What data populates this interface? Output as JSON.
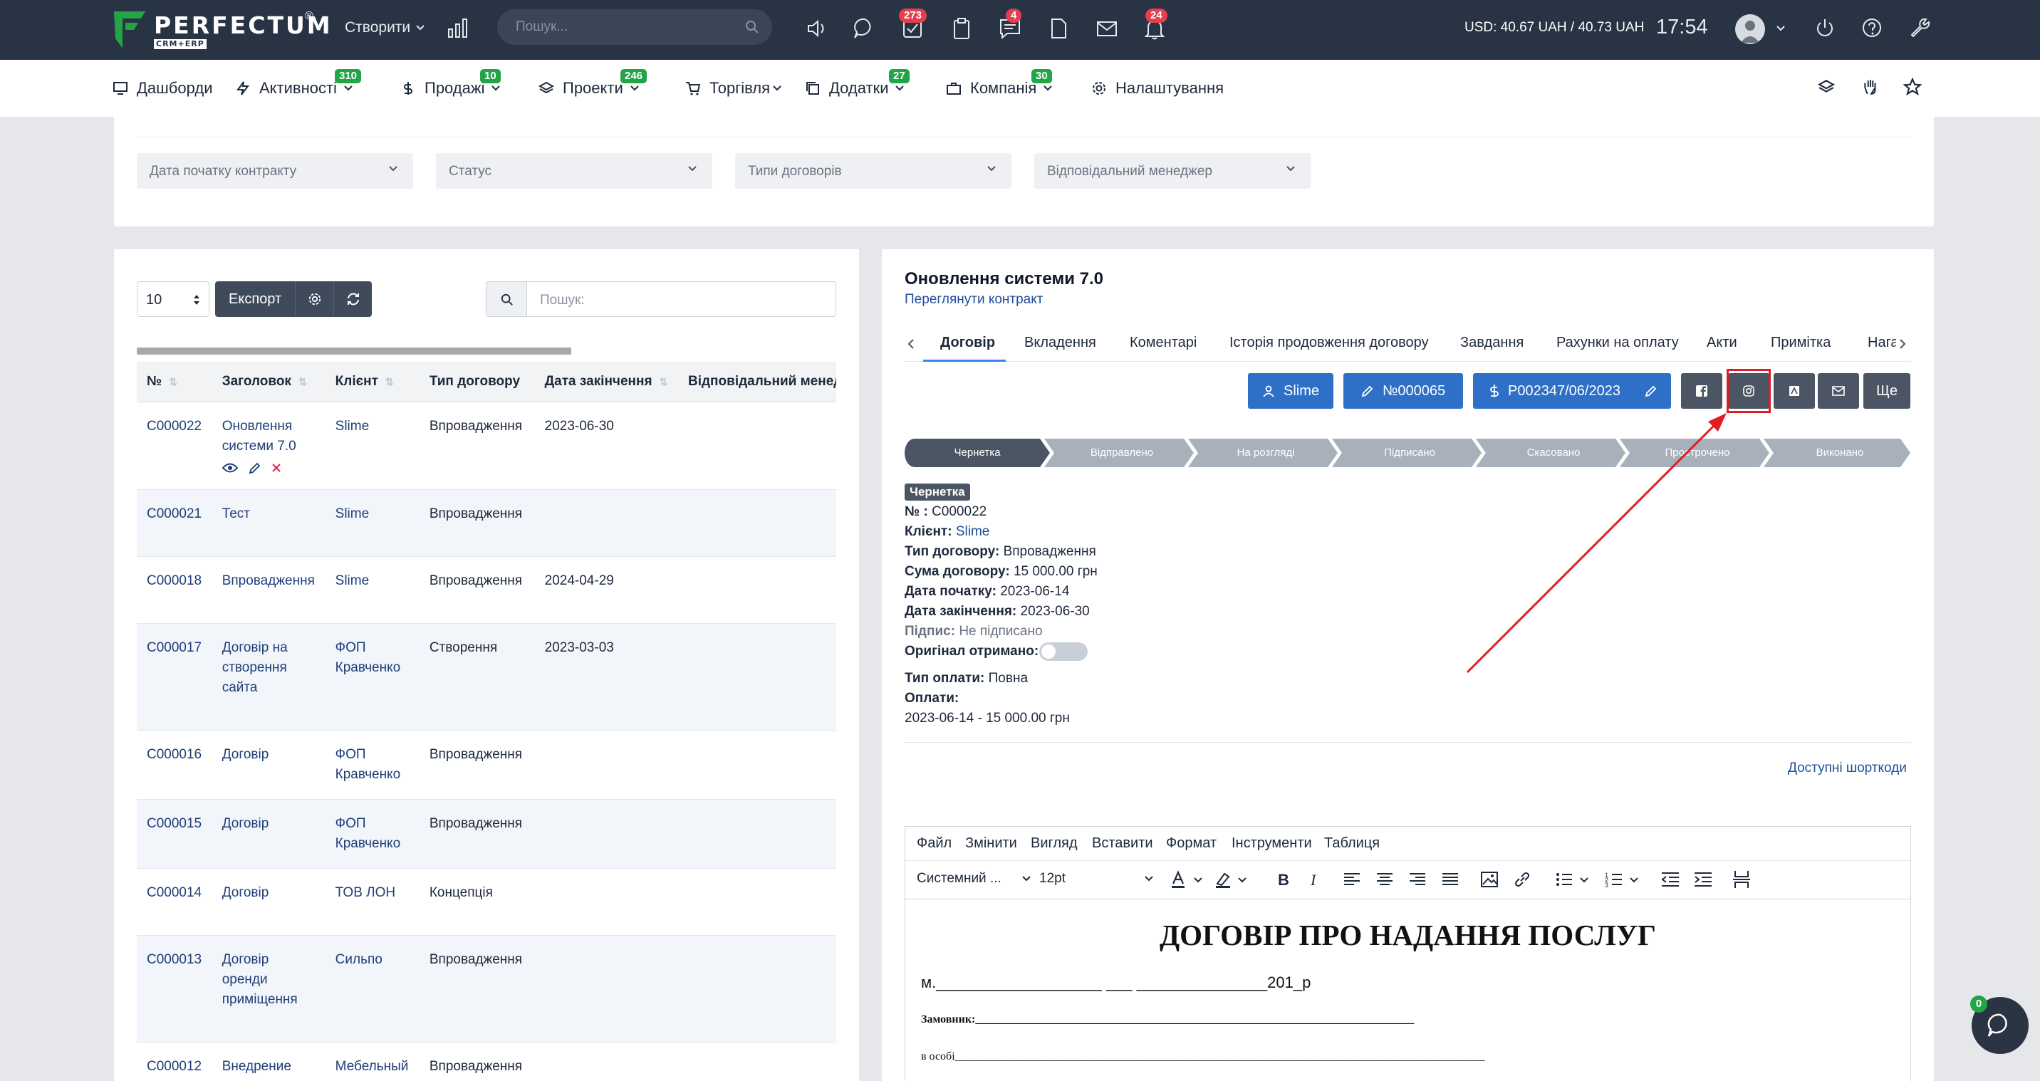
{
  "topbar": {
    "logo_text": "PERFECTUM",
    "logo_sub": "CRM+ERP",
    "logo_reg": "®",
    "create_label": "Створити",
    "search_placeholder": "Пошук...",
    "badges": {
      "tasks": "273",
      "chat": "4",
      "notifications": "24"
    },
    "rate": "USD: 40.67 UAH / 40.73 UAH",
    "clock": "17:54"
  },
  "nav": {
    "items": [
      {
        "label": "Дашборди",
        "badge": ""
      },
      {
        "label": "Активності",
        "badge": "310"
      },
      {
        "label": "Продажі",
        "badge": "10"
      },
      {
        "label": "Проекти",
        "badge": "246"
      },
      {
        "label": "Торгівля",
        "badge": ""
      },
      {
        "label": "Додатки",
        "badge": "27"
      },
      {
        "label": "Компанія",
        "badge": "30"
      },
      {
        "label": "Налаштування",
        "badge": ""
      }
    ]
  },
  "filters": [
    "Дата початку контракту",
    "Статус",
    "Типи договорів",
    "Відповідальний менеджер"
  ],
  "table": {
    "page_size": "10",
    "export_label": "Експорт",
    "search_placeholder": "Пошук:",
    "headers": [
      "№",
      "Заголовок",
      "Клієнт",
      "Тип договору",
      "Дата закінчення",
      "Відповідальний менеджер"
    ],
    "rows": [
      {
        "id": "C000022",
        "title": "Оновлення системи 7.0",
        "client": "Slime",
        "type": "Впровадження",
        "end": "2023-06-30"
      },
      {
        "id": "C000021",
        "title": "Тест",
        "client": "Slime",
        "type": "Впровадження",
        "end": ""
      },
      {
        "id": "C000018",
        "title": "Впровадження",
        "client": "Slime",
        "type": "Впровадження",
        "end": "2024-04-29"
      },
      {
        "id": "C000017",
        "title": "Договір на створення сайта",
        "client": "ФОП Кравченко",
        "type": "Створення",
        "end": "2023-03-03"
      },
      {
        "id": "C000016",
        "title": "Договір",
        "client": "ФОП Кравченко",
        "type": "Впровадження",
        "end": ""
      },
      {
        "id": "C000015",
        "title": "Договір",
        "client": "ФОП Кравченко",
        "type": "Впровадження",
        "end": ""
      },
      {
        "id": "C000014",
        "title": "Договір",
        "client": "ТОВ ЛОН",
        "type": "Концепція",
        "end": ""
      },
      {
        "id": "C000013",
        "title": "Договір оренди приміщення",
        "client": "Сильпо",
        "type": "Впровадження",
        "end": ""
      },
      {
        "id": "C000012",
        "title": "Внедрение модуля",
        "client": "Мебельный мир",
        "type": "Впровадження",
        "end": ""
      }
    ]
  },
  "detail": {
    "title": "Оновлення системи 7.0",
    "view_link": "Переглянути контракт",
    "tabs": [
      "Договір",
      "Вкладення",
      "Коментарі",
      "Історія продовження договору",
      "Завдання",
      "Рахунки на оплату",
      "Акти",
      "Примітка",
      "Нага"
    ],
    "buttons": {
      "client": "Slime",
      "number": "№000065",
      "invoice": "P002347/06/2023",
      "more": "Ще"
    },
    "pipeline": [
      "Чернетка",
      "Відправлено",
      "На розгляді",
      "Підписано",
      "Скасовано",
      "Прострочено",
      "Виконано"
    ],
    "status_badge": "Чернетка",
    "fields": {
      "number_label": "№ :",
      "number": "C000022",
      "client_label": "Клієнт:",
      "client": "Slime",
      "type_label": "Тип договору:",
      "type": "Впровадження",
      "sum_label": "Сума договору:",
      "sum": "15 000.00 грн",
      "start_label": "Дата початку:",
      "start": "2023-06-14",
      "end_label": "Дата закінчення:",
      "end": "2023-06-30",
      "sign_label": "Підпис:",
      "sign": "Не підписано",
      "original_label": "Оригінал отримано:",
      "paytype_label": "Тип оплати:",
      "paytype": "Повна",
      "payments_label": "Оплати:",
      "payment_1": "2023-06-14 - 15 000.00 грн"
    },
    "shortcodes": "Доступні шорткоди"
  },
  "editor": {
    "menus": [
      "Файл",
      "Змінити",
      "Вигляд",
      "Вставити",
      "Формат",
      "Інструменти",
      "Таблиця"
    ],
    "font": "Системний ...",
    "size": "12pt",
    "doc_title": "ДОГОВІР ПРО НАДАННЯ ПОСЛУГ",
    "line1": "м.___________________ ___ _______________201_р",
    "line2": "Замовник:_____________________________________________________________________________",
    "line3": "в особі_____________________________________________________________________________________________"
  },
  "chat_badge": "0"
}
